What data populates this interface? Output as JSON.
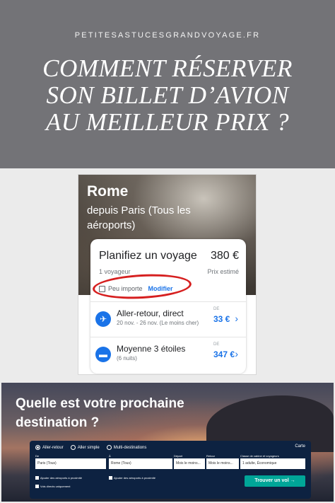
{
  "header": {
    "site": "PETITESASTUCESGRANDVOYAGE.FR",
    "title_lines": [
      "COMMENT RÉSERVER",
      "SON BILLET D’AVION",
      "AU MEILLEUR PRIX ?"
    ]
  },
  "google_card": {
    "city": "Rome",
    "from_prefix": "depuis",
    "from_city": "Paris (Tous les aéroports)",
    "plan": {
      "title": "Planifiez un voyage",
      "price": "380 €",
      "travellers": "1 voyageur",
      "price_label": "Prix estimé",
      "dates": "Peu importe",
      "modify": "Modifier"
    },
    "options": [
      {
        "icon": "plane-icon",
        "name": "Aller-retour, direct",
        "detail": "20 nov. - 26 nov. (Le moins cher)",
        "from": "DE",
        "price": "33 €"
      },
      {
        "icon": "bed-icon",
        "name": "Moyenne 3 étoiles",
        "detail": "(6 nuits)",
        "from": "DE",
        "price": "347 €"
      }
    ]
  },
  "skyscanner": {
    "headline": "Quelle est votre prochaine destination ?",
    "trip_types": [
      "Aller-retour",
      "Aller simple",
      "Multi-destinations"
    ],
    "selected_trip": "Aller-retour",
    "map_link": "Carte",
    "labels": {
      "from": "De",
      "to": "À",
      "depart": "Départ",
      "return": "Retour",
      "cabin": "Classe de cabine et voyageurs"
    },
    "values": {
      "from": "Paris (Tous)",
      "to": "Rome (Tous)",
      "depart": "Mois le moins...",
      "return": "Mois le moins...",
      "cabin": "1 adulte, Économique"
    },
    "checkboxes": [
      "Ajouter des aéroports à proximité",
      "Ajouter des aéroports à proximité",
      "Vols directs uniquement"
    ],
    "search_button": "Trouver un vol →"
  },
  "colors": {
    "header_bg": "#737377",
    "accent_blue": "#1a73e8",
    "highlight_red": "#d61f1f",
    "search_green": "#00a698",
    "form_navy": "#0d2241"
  }
}
